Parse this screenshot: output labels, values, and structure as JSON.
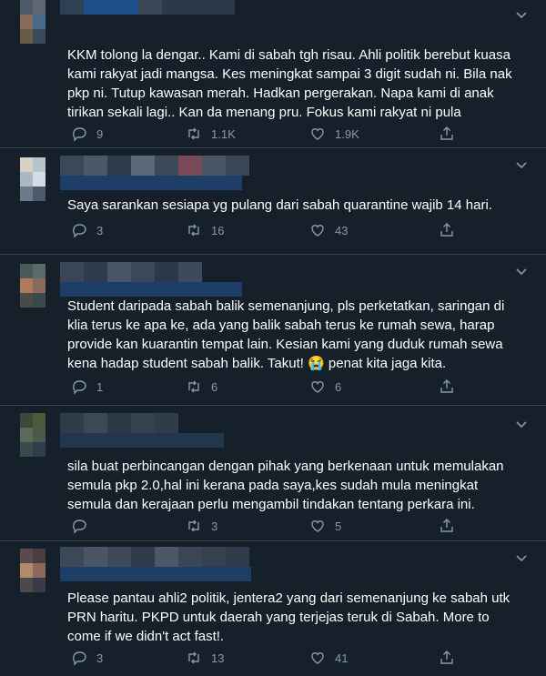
{
  "tweets": [
    {
      "text": "KKM tolong la dengar.. Kami di sabah tgh risau. Ahli politik berebut kuasa\nkami rakyat jadi mangsa. Kes meningkat sampai 3 digit sudah ni. Bila nak\npkp ni. Tutup kawasan merah. Hadkan pergerakan. Napa kami di anak\ntirikan sekali lagi.. Kan da menang pru. Fokus kami rakyat ni pula",
      "replies": "9",
      "retweets": "1.1K",
      "likes": "1.9K"
    },
    {
      "text": "Saya sarankan sesiapa yg pulang dari sabah quarantine wajib 14 hari.",
      "replies": "3",
      "retweets": "16",
      "likes": "43"
    },
    {
      "text": "Student daripada sabah balik semenanjung, pls perketatkan, saringan di\nklia terus ke apa ke, ada yang balik sabah terus ke rumah sewa, harap\nprovide kan kuarantin tempat lain. Kesian kami yang duduk rumah sewa\nkena hadap student sabah balik. Takut! 😭 penat kita jaga kita.",
      "replies": "1",
      "retweets": "6",
      "likes": "6"
    },
    {
      "text": "sila buat perbincangan dengan pihak yang berkenaan untuk memulakan\nsemula pkp 2.0,hal ini kerana pada saya,kes sudah mula meningkat\nsemula dan kerajaan perlu mengambil tindakan tentang perkara ini.",
      "replies": "",
      "retweets": "3",
      "likes": "5"
    },
    {
      "text": "Please pantau ahli2 politik, jentera2 yang dari semenanjung ke sabah utk\nPRN haritu. PKPD untuk daerah yang terjejas teruk di Sabah. More to\ncome if we didn't act fast!.",
      "replies": "3",
      "retweets": "13",
      "likes": "41"
    }
  ],
  "colors": {
    "background": "#15202b",
    "divider": "#38444d",
    "muted": "#8899a6",
    "text": "#ffffff"
  },
  "icons": [
    "reply-icon",
    "retweet-icon",
    "like-icon",
    "share-icon",
    "chevron-down-icon"
  ]
}
